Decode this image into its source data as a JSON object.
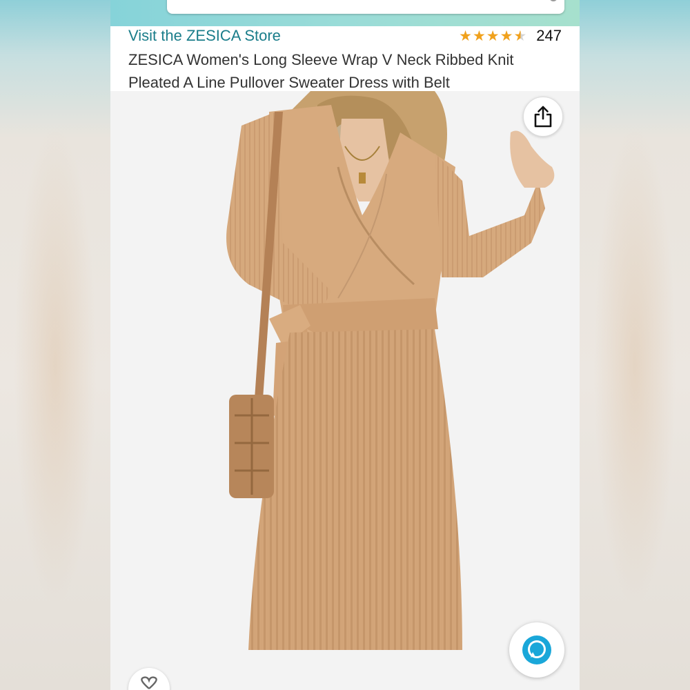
{
  "store": {
    "link_label": "Visit the ZESICA Store"
  },
  "rating": {
    "stars": 4.5,
    "count": "247",
    "star_color": "#f0a11c"
  },
  "product": {
    "title": "ZESICA Women's Long Sleeve Wrap V Neck Ribbed Knit Pleated A Line Pullover Sweater Dress with Belt",
    "dress_color": "#d4a67a"
  },
  "icons": {
    "share": "share-icon",
    "alexa": "alexa-icon",
    "wishlist": "heart-icon"
  },
  "colors": {
    "link": "#1a7d8a",
    "header_band": "#86d3d9",
    "alexa_blue": "#1aa7d9"
  }
}
